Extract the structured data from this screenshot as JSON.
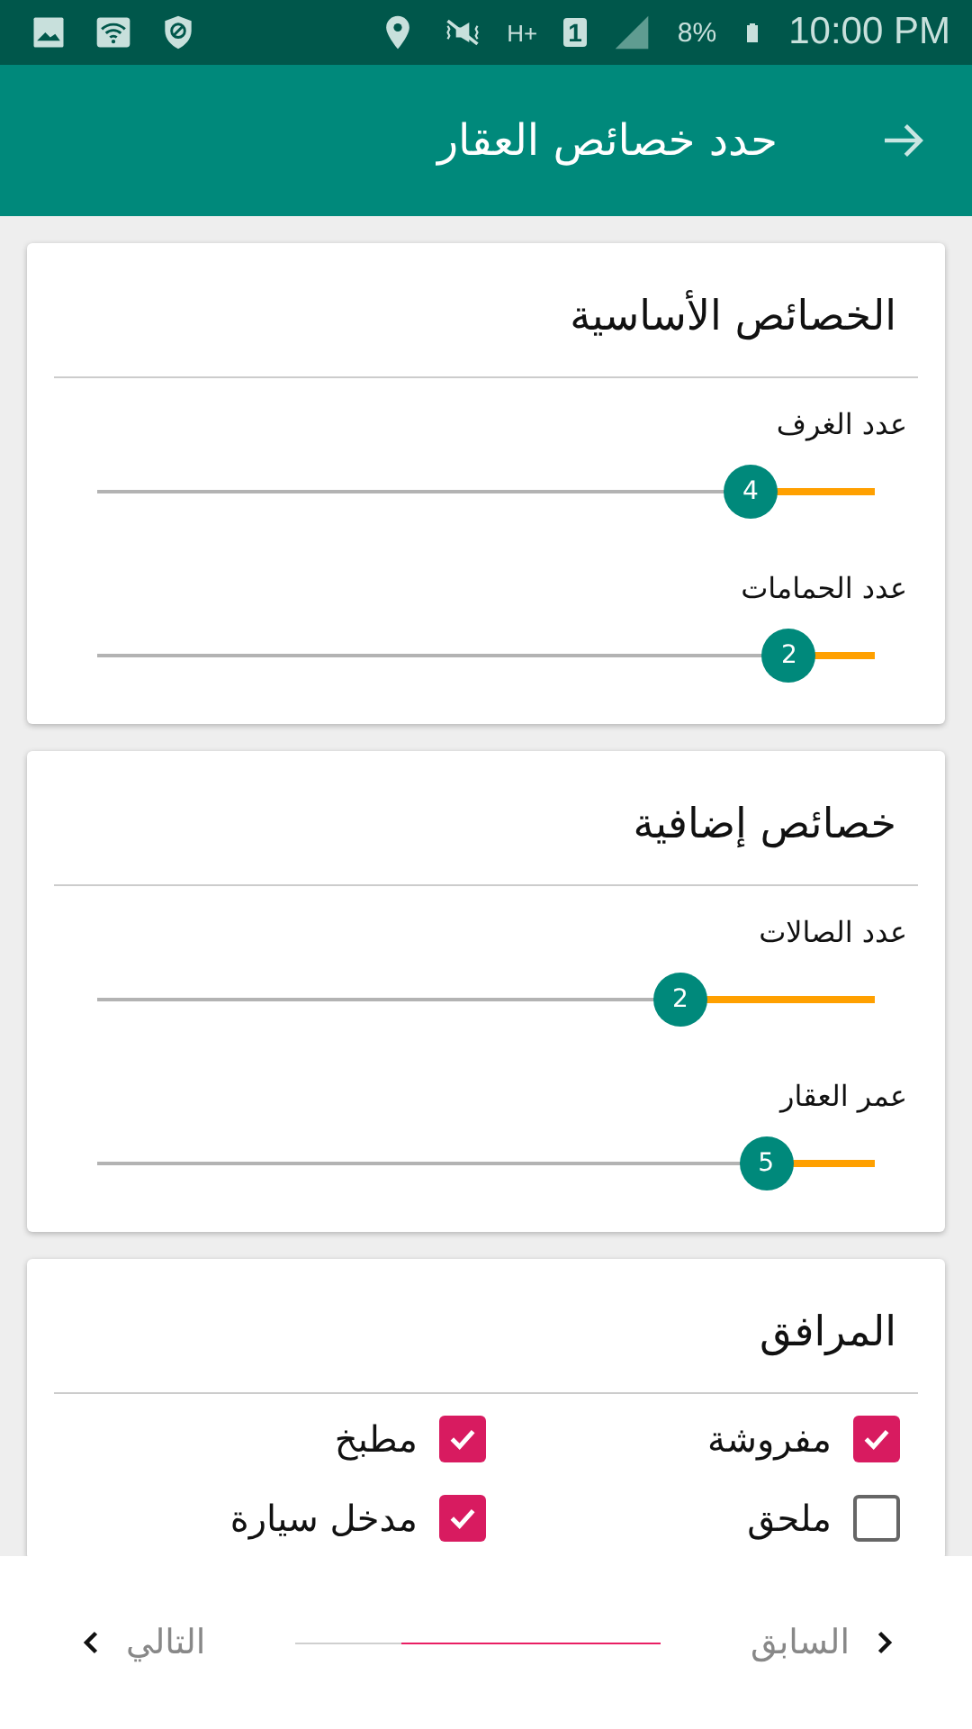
{
  "status_bar": {
    "network": "H+",
    "sim": "1",
    "battery": "8%",
    "time": "10:00 PM"
  },
  "app_bar": {
    "title": "حدد خصائص العقار"
  },
  "sections": [
    {
      "title": "الخصائص الأساسية",
      "kind": "sliders",
      "sliders": [
        {
          "label": "عدد الغرف",
          "value": "4",
          "level": 0.16
        },
        {
          "label": "عدد الحمامات",
          "value": "2",
          "level": 0.11
        }
      ]
    },
    {
      "title": "خصائص إضافية",
      "kind": "sliders",
      "sliders": [
        {
          "label": "عدد الصالات",
          "value": "2",
          "level": 0.25
        },
        {
          "label": "عمر العقار",
          "value": "5",
          "level": 0.14
        }
      ]
    },
    {
      "title": "المرافق",
      "kind": "checkboxes",
      "options": [
        {
          "label": "مفروشة",
          "checked": true
        },
        {
          "label": "مطبخ",
          "checked": true
        },
        {
          "label": "ملحق",
          "checked": false
        },
        {
          "label": "مدخل سيارة",
          "checked": true
        }
      ]
    }
  ],
  "footer": {
    "previous": "السابق",
    "next": "التالي",
    "progress": {
      "level": 0.71
    }
  }
}
